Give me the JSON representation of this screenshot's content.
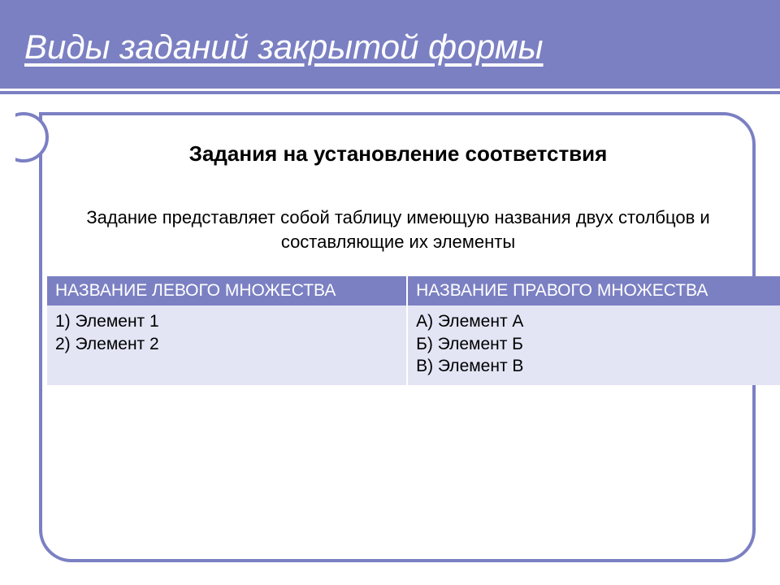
{
  "header": {
    "title": "Виды заданий закрытой формы"
  },
  "content": {
    "subtitle": "Задания на установление соответствия",
    "description": "Задание представляет собой таблицу имеющую названия двух столбцов и составляющие их элементы"
  },
  "table": {
    "headers": {
      "left": "НАЗВАНИЕ ЛЕВОГО МНОЖЕСТВА",
      "right": "НАЗВАНИЕ ПРАВОГО МНОЖЕСТВА"
    },
    "left_items": {
      "0": "1)  Элемент 1",
      "1": "2)  Элемент 2"
    },
    "right_items": {
      "0": "А) Элемент А",
      "1": "Б) Элемент Б",
      "2": "В) Элемент В"
    }
  }
}
